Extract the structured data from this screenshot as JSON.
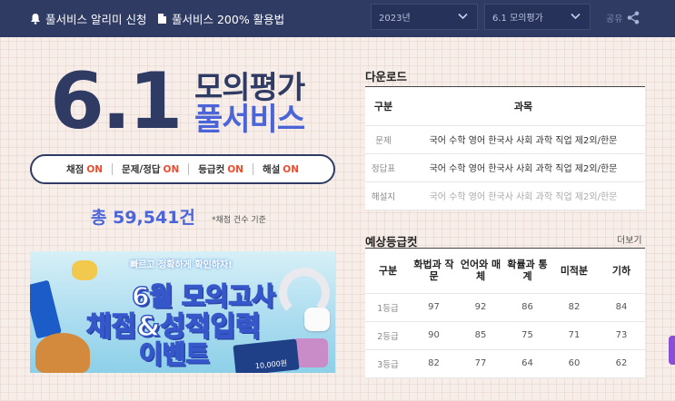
{
  "topbar": {
    "alarm_label": "풀서비스 알리미 신청",
    "guide_label": "풀서비스 200% 활용법",
    "year_select": "2023년",
    "exam_select": "6.1 모의평가",
    "share_label": "공유"
  },
  "hero": {
    "number": "6.1",
    "title_line1": "모의평가",
    "title_line2": "풀서비스",
    "status": [
      {
        "label": "채점",
        "state": "ON"
      },
      {
        "label": "문제/정답",
        "state": "ON"
      },
      {
        "label": "등급컷",
        "state": "ON"
      },
      {
        "label": "해설",
        "state": "ON"
      }
    ],
    "total": "총 59,541건",
    "total_note": "*채점 건수 기준"
  },
  "banner": {
    "subtitle": "빠르고 정확하게 확인하자!",
    "line1": "6월 모의고사",
    "line2": "채점&성적입력",
    "line3": "이벤트",
    "card_text": "10,000원"
  },
  "download": {
    "title": "다운로드",
    "headers": [
      "구분",
      "과목"
    ],
    "rows": [
      {
        "label": "문제",
        "subjects": "국어 수학 영어 한국사 사회 과학 직업 제2외/한문"
      },
      {
        "label": "정답표",
        "subjects": "국어 수학 영어 한국사 사회 과학 직업 제2외/한문"
      },
      {
        "label": "해설지",
        "subjects": "국어 수학 영어 한국사 사회 과학 직업 제2외/한문"
      }
    ]
  },
  "grade_cut": {
    "title": "예상등급컷",
    "more_label": "더보기",
    "headers": [
      "구분",
      "화법과 작문",
      "언어와 매체",
      "확률과 통계",
      "미적분",
      "기하"
    ],
    "rows": [
      {
        "label": "1등급",
        "values": [
          "97",
          "92",
          "86",
          "82",
          "84"
        ]
      },
      {
        "label": "2등급",
        "values": [
          "90",
          "85",
          "75",
          "71",
          "73"
        ]
      },
      {
        "label": "3등급",
        "values": [
          "82",
          "77",
          "64",
          "60",
          "62"
        ]
      }
    ]
  },
  "colors": {
    "navy": "#2f3b63",
    "accent_blue": "#4b64d8",
    "on_red": "#ef4c2e"
  }
}
